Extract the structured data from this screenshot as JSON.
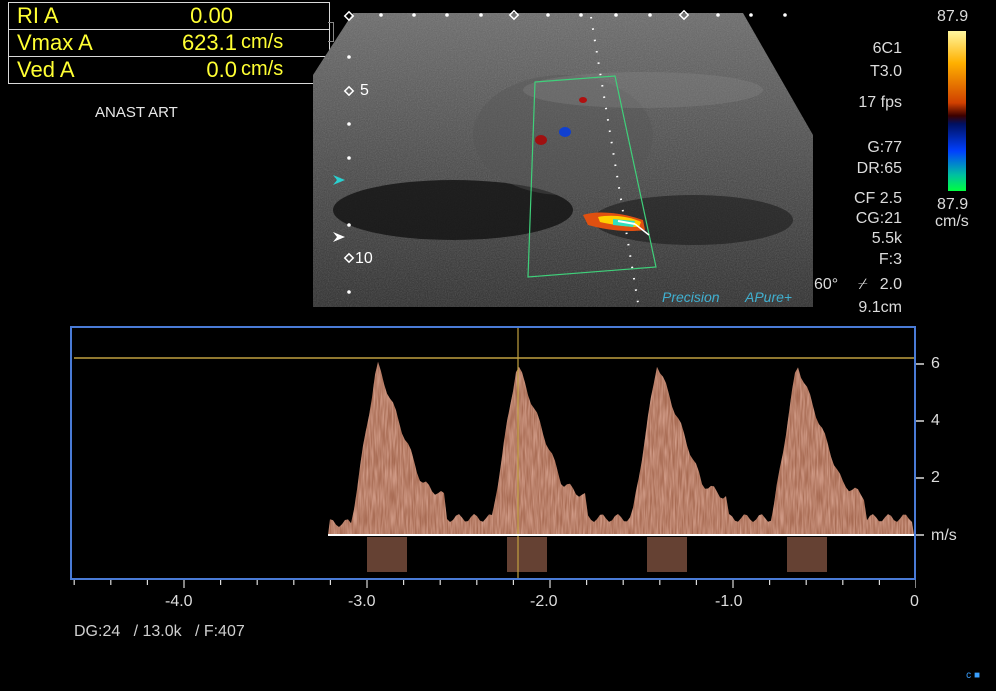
{
  "measurements": {
    "rows": [
      {
        "label": "RI  A",
        "value": "0.00",
        "unit": ""
      },
      {
        "label": "Vmax  A",
        "value": "623.1",
        "unit": "cm/s"
      },
      {
        "label": "Ved A",
        "value": "0.0",
        "unit": "cm/s"
      }
    ]
  },
  "annotation": "ANAST ART",
  "params": {
    "probe": "6C1",
    "t": "T3.0",
    "fps": "17 fps",
    "gain": "G:77",
    "dr": "DR:65",
    "cf": "CF 2.5",
    "cg": "CG:21",
    "prf": "5.5k",
    "filter": "F:3",
    "angle": "60°",
    "angle_corr": "2.0",
    "depth": "9.1cm"
  },
  "color_bar": {
    "top_label": "87.9",
    "bottom_label": "87.9",
    "unit": "cm/s"
  },
  "depth_markers": [
    "5",
    "10"
  ],
  "logos": {
    "precision": "Precision",
    "apure": "APure+"
  },
  "doppler": {
    "y_ticks": [
      "6",
      "4",
      "2"
    ],
    "y_unit": "m/s",
    "x_ticks": [
      "-4.0",
      "-3.0",
      "-2.0",
      "-1.0",
      "0"
    ]
  },
  "footer": "DG:24   / 13.0k   / F:407",
  "corner": "c",
  "colors": {
    "yellow": "#ffff33",
    "frame_blue": "#4a7bd6",
    "spectrum": "#e09070"
  }
}
